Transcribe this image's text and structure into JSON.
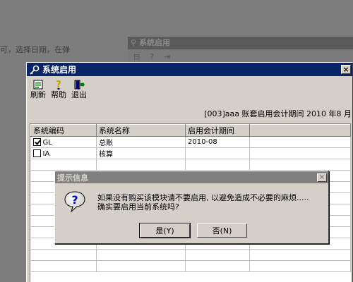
{
  "background": {
    "text": "可，选择日期，在弹",
    "window_title": "系统启用",
    "toolbar_glyphs": [
      "⊟",
      "?",
      "⇥"
    ]
  },
  "window": {
    "title": "系统启用",
    "close": "×",
    "toolbar": {
      "refresh_label": "刷新",
      "help_label": "帮助",
      "exit_label": "退出"
    },
    "period_text": "[003]aaa 账套启用会计期间 2010 年8 月",
    "table": {
      "headers": [
        "系统编码",
        "系统名称",
        "启用会计期间",
        ""
      ],
      "rows": [
        {
          "checked": true,
          "code": "GL",
          "name": "总账",
          "period": "2010-08"
        },
        {
          "checked": false,
          "code": "IA",
          "name": "核算",
          "period": ""
        }
      ]
    }
  },
  "message_box": {
    "title": "提示信息",
    "close": "×",
    "icon": "question-icon",
    "line1": "如果没有购买该模块请不要启用, 以避免造成不必要的麻烦.....",
    "line2": "确实要启用当前系统吗?",
    "yes_label": "是(Y)",
    "no_label": "否(N)"
  },
  "colors": {
    "active_title": "#0a246a",
    "inactive_title": "#808080",
    "face": "#d4d0c8"
  }
}
